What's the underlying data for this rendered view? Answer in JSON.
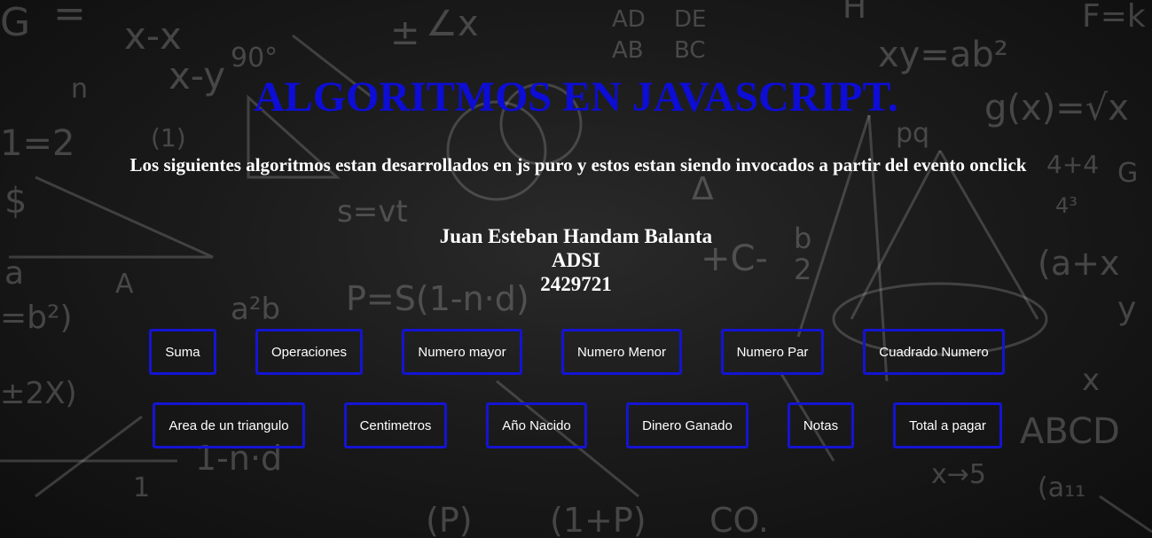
{
  "page": {
    "title": "ALGORITMOS EN JAVASCRIPT.",
    "subtitle": "Los siguientes algoritmos estan desarrollados en js puro y estos estan siendo invocados a partir del evento onclick",
    "author": {
      "name": "Juan Esteban Handam Balanta",
      "program": "ADSI",
      "id": "2429721"
    }
  },
  "buttons": {
    "suma": "Suma",
    "operaciones": "Operaciones",
    "numero_mayor": "Numero mayor",
    "numero_menor": "Numero Menor",
    "numero_par": "Numero Par",
    "cuadrado_numero": "Cuadrado Numero",
    "area_triangulo": "Area de un triangulo",
    "centimetros": "Centimetros",
    "ano_nacido": "Año Nacido",
    "dinero_ganado": "Dinero Ganado",
    "notas": "Notas",
    "total_pagar": "Total a pagar"
  },
  "colors": {
    "title": "#0d0dd6",
    "button_border": "#1414d2",
    "text": "#ffffff",
    "background": "#1b1b1b"
  }
}
